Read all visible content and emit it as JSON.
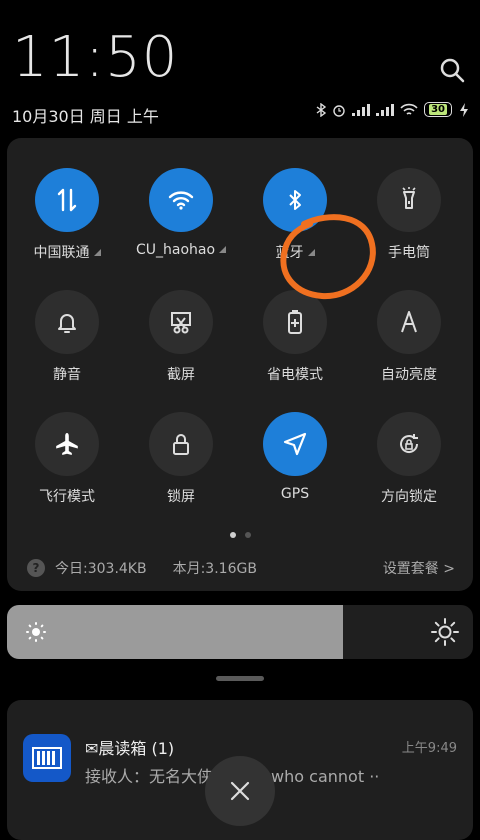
{
  "header": {
    "time": "11:50",
    "date": "10月30日 周日 上午",
    "battery": "30"
  },
  "toggles": [
    {
      "label": "中国联通",
      "icon": "data-transfer-icon",
      "active": true,
      "expandable": true
    },
    {
      "label": "CU_haohao",
      "icon": "wifi-icon",
      "active": true,
      "expandable": true
    },
    {
      "label": "蓝牙",
      "icon": "bluetooth-icon",
      "active": true,
      "expandable": true
    },
    {
      "label": "手电筒",
      "icon": "flashlight-icon",
      "active": false,
      "expandable": false
    },
    {
      "label": "静音",
      "icon": "bell-icon",
      "active": false,
      "expandable": false
    },
    {
      "label": "截屏",
      "icon": "screenshot-icon",
      "active": false,
      "expandable": false
    },
    {
      "label": "省电模式",
      "icon": "battery-saver-icon",
      "active": false,
      "expandable": false
    },
    {
      "label": "自动亮度",
      "icon": "auto-brightness-icon",
      "active": false,
      "expandable": false
    },
    {
      "label": "飞行模式",
      "icon": "airplane-icon",
      "active": false,
      "expandable": false
    },
    {
      "label": "锁屏",
      "icon": "lock-icon",
      "active": false,
      "expandable": false
    },
    {
      "label": "GPS",
      "icon": "location-arrow-icon",
      "active": true,
      "expandable": false
    },
    {
      "label": "方向锁定",
      "icon": "rotation-lock-icon",
      "active": false,
      "expandable": false
    }
  ],
  "pager": {
    "pages": 2,
    "current": 1
  },
  "usage": {
    "today": "今日:303.4KB",
    "month": "本月:3.16GB",
    "settings": "设置套餐 >"
  },
  "brightness": {
    "level": 0.72
  },
  "notification": {
    "title": "✉晨读箱 (1)",
    "time": "上午9:49",
    "body": "接收人：无名大侠    Those who cannot ··"
  },
  "colors": {
    "accent": "#1e7fd9",
    "annotation": "#f07020"
  }
}
